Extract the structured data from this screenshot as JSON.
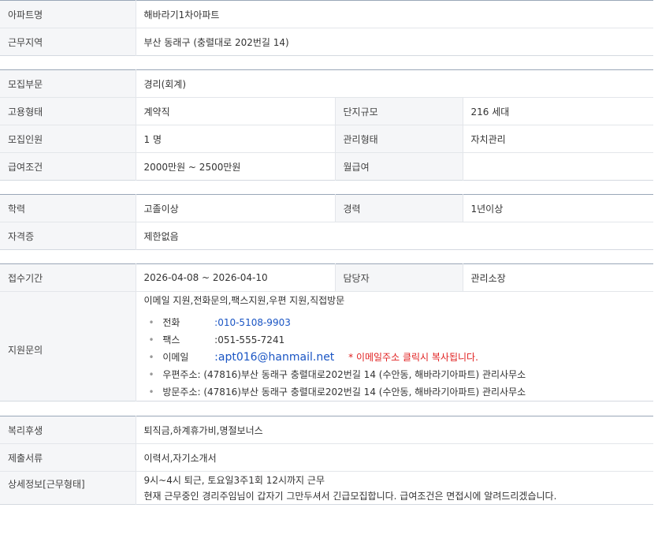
{
  "apartment": {
    "label": "아파트명",
    "value": "해바라기1차아파트"
  },
  "work_area": {
    "label": "근무지역",
    "value": "부산  동래구 (충렬대로 202번길 14)"
  },
  "recruit": {
    "field": {
      "label": "모집부문",
      "value": "경리(회계)"
    },
    "employment": {
      "label": "고용형태",
      "value": "계약직"
    },
    "complex_size": {
      "label": "단지규모",
      "value": "216 세대"
    },
    "headcount": {
      "label": "모집인원",
      "value": "1 명"
    },
    "management_type": {
      "label": "관리형태",
      "value": "자치관리"
    },
    "salary": {
      "label": "급여조건",
      "value": "2000만원 ~ 2500만원"
    },
    "pay_type": {
      "label": "월급여",
      "value": ""
    }
  },
  "qualification": {
    "education": {
      "label": "학력",
      "value": "고졸이상"
    },
    "experience": {
      "label": "경력",
      "value": "1년이상"
    },
    "certificate": {
      "label": "자격증",
      "value": "제한없음"
    }
  },
  "apply": {
    "period": {
      "label": "접수기간",
      "value": "2026-04-08 ~ 2026-04-10"
    },
    "manager": {
      "label": "담당자",
      "value": "관리소장"
    },
    "inquiry": {
      "label": "지원문의",
      "methods": "이메일 지원,전화문의,팩스지원,우편 지원,직접방문",
      "phone": {
        "label": "전화",
        "value": ":010-5108-9903"
      },
      "fax": {
        "label": "팩스",
        "value": ":051-555-7241"
      },
      "email": {
        "label": "이메일",
        "value": ":apt016@hanmail.net",
        "note": "* 이메일주소 클릭시 복사됩니다."
      },
      "postal": {
        "label": "우편주소",
        "value": ": (47816)부산 동래구 충렬대로202번길 14 (수안동, 해바라기아파트) 관리사무소"
      },
      "visit": {
        "label": "방문주소",
        "value": ": (47816)부산 동래구 충렬대로202번길 14 (수안동, 해바라기아파트) 관리사무소"
      }
    }
  },
  "benefits": {
    "welfare": {
      "label": "복리후생",
      "value": "퇴직금,하계휴가비,명절보너스"
    },
    "documents": {
      "label": "제출서류",
      "value": "이력서,자기소개서"
    },
    "detail": {
      "label": "상세정보[근무형태]",
      "lines": [
        "9시~4시 퇴근, 토요일3주1회 12시까지 근무",
        "현재 근무중인 경리주임님이 갑자기 그만두셔서 긴급모집합니다. 급여조건은 면접시에 알려드리겠습니다."
      ]
    }
  },
  "colors": {
    "accent_red": "#e02020",
    "link_blue": "#1a55c4",
    "header_bg": "#f5f6f8",
    "border_top": "#9aa7b8"
  }
}
